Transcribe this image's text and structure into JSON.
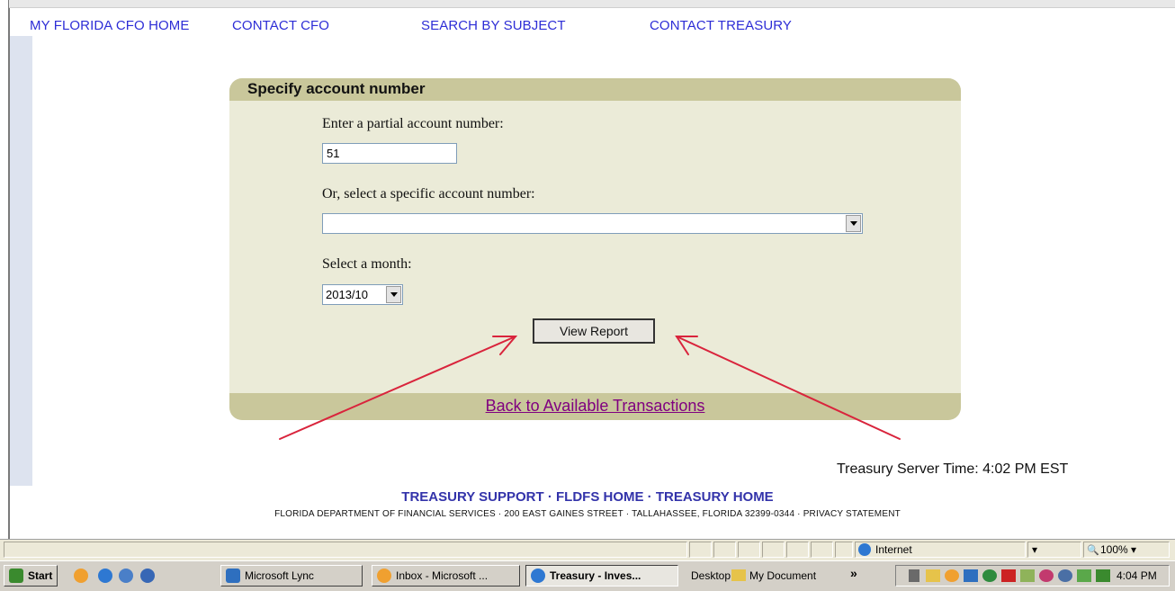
{
  "nav": {
    "home": "MY FLORIDA CFO HOME",
    "contact_cfo": "CONTACT CFO",
    "search": "SEARCH BY SUBJECT",
    "contact_treasury": "CONTACT TREASURY"
  },
  "panel": {
    "title": "Specify account number",
    "partial_label": "Enter a partial account number:",
    "partial_value": "51",
    "select_label": "Or, select a specific account number:",
    "account_selected": "",
    "month_label": "Select a month:",
    "month_selected": "2013/10",
    "view_report": "View Report",
    "back_link": "Back to Available Transactions"
  },
  "server_time": "Treasury Server Time: 4:02 PM EST",
  "footer": {
    "support": "TREASURY SUPPORT",
    "sep": "·",
    "fldfs": "FLDFS HOME",
    "home": "TREASURY HOME",
    "address": "FLORIDA DEPARTMENT OF FINANCIAL SERVICES · 200 EAST GAINES STREET · TALLAHASSEE, FLORIDA 32399-0344 · PRIVACY STATEMENT"
  },
  "statusbar": {
    "zone": "Internet",
    "zoom": "100%"
  },
  "taskbar": {
    "start": "Start",
    "items": [
      "Microsoft Lync",
      "Inbox - Microsoft ...",
      "Treasury - Inves...",
      "Desktop",
      "My Document"
    ],
    "overflow": "»",
    "clock": "4:04 PM"
  },
  "colors": {
    "panel_bg": "#ebebd8",
    "panel_band": "#c9c79b",
    "nav_link": "#2d2dd6",
    "arrow": "#d9243c",
    "visited_link": "#800080"
  }
}
